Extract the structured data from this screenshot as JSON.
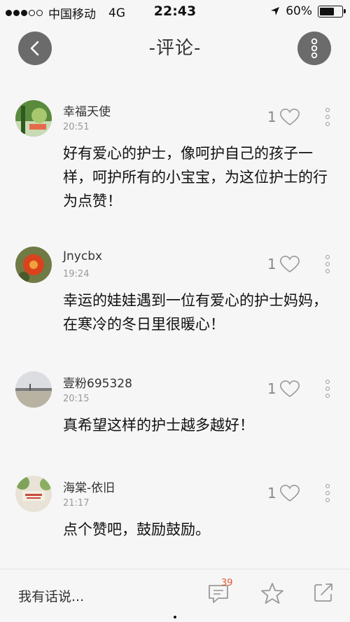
{
  "status_bar": {
    "carrier": "中国移动",
    "network": "4G",
    "time": "22:43",
    "battery": "60%"
  },
  "nav": {
    "title": "-评论-"
  },
  "comments": [
    {
      "username": "幸福天使",
      "time": "20:51",
      "likes": "1",
      "content": "好有爱心的护士，像呵护自己的孩子一样，呵护所有的小宝宝，为这位护士的行为点赞！",
      "avatar": "avatar-green-photo"
    },
    {
      "username": "Jnycbx",
      "time": "19:24",
      "likes": "1",
      "content": "幸运的娃娃遇到一位有爱心的护士妈妈，在寒冷的冬日里很暖心！",
      "avatar": "avatar-red-flower"
    },
    {
      "username": "壹粉695328",
      "time": "20:15",
      "likes": "1",
      "content": "真希望这样的护士越多越好！",
      "avatar": "avatar-lake-landscape"
    },
    {
      "username": "海棠-依旧",
      "time": "21:17",
      "likes": "1",
      "content": "点个赞吧，鼓励鼓励。",
      "avatar": "avatar-calligraphy-card"
    }
  ],
  "bottom_bar": {
    "input_placeholder": "我有话说...",
    "comment_count": "39",
    "icons": [
      "comment-icon",
      "star-icon",
      "share-icon"
    ]
  },
  "colors": {
    "background": "#f7f6f7",
    "badge": "#e4572e",
    "nav_button": "#6b6b6b"
  }
}
